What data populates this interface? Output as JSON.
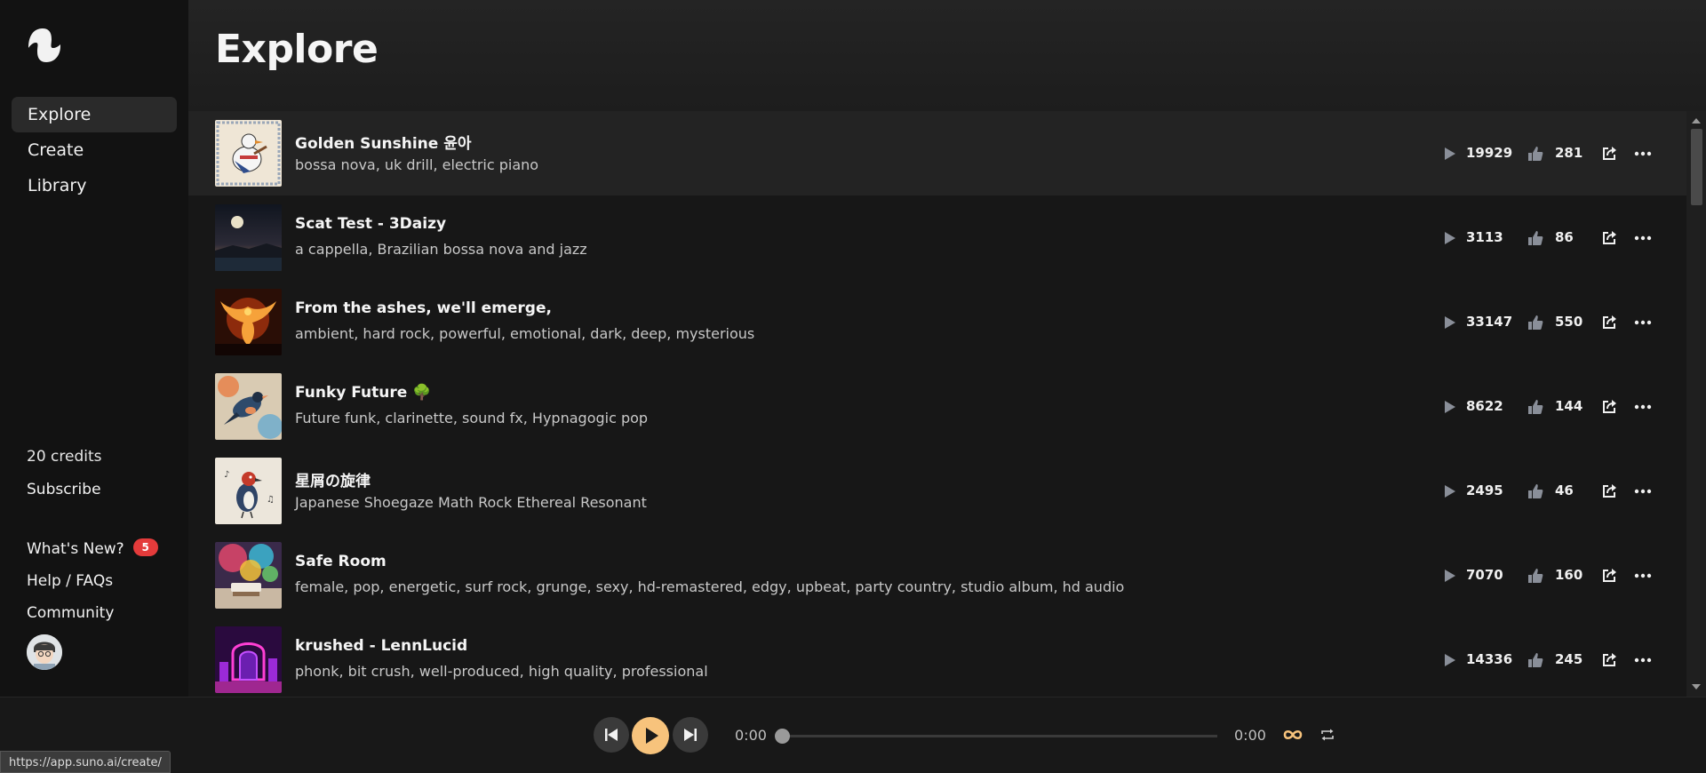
{
  "sidebar": {
    "nav": [
      {
        "label": "Explore",
        "active": true
      },
      {
        "label": "Create"
      },
      {
        "label": "Library"
      }
    ],
    "credits": "20 credits",
    "subscribe": "Subscribe",
    "links": [
      {
        "label": "What's New?",
        "badge": "5"
      },
      {
        "label": "Help / FAQs"
      },
      {
        "label": "Community"
      }
    ]
  },
  "header": {
    "title": "Explore"
  },
  "songs": [
    {
      "title": "Golden Sunshine 윤아",
      "tags": "bossa nova, uk drill, electric piano",
      "plays": "19929",
      "likes": "281",
      "art": "goose"
    },
    {
      "title": "Scat Test - 3Daizy",
      "tags": "a cappella, Brazilian bossa nova and jazz",
      "plays": "3113",
      "likes": "86",
      "art": "moon"
    },
    {
      "title": "From the ashes, we'll emerge,",
      "tags": "ambient, hard rock, powerful, emotional, dark, deep, mysterious",
      "plays": "33147",
      "likes": "550",
      "art": "phoenix"
    },
    {
      "title": "Funky Future 🌳",
      "tags": "Future funk, clarinette, sound fx, Hypnagogic pop",
      "plays": "8622",
      "likes": "144",
      "art": "bird-blue"
    },
    {
      "title": "星屑の旋律",
      "tags": "Japanese Shoegaze Math Rock Ethereal Resonant",
      "plays": "2495",
      "likes": "46",
      "art": "bird-red"
    },
    {
      "title": "Safe Room",
      "tags": "female, pop, energetic, surf rock, grunge, sexy, hd-remastered, edgy, upbeat, party country, studio album, hd audio",
      "plays": "7070",
      "likes": "160",
      "art": "room"
    },
    {
      "title": "krushed - LennLucid",
      "tags": "phonk, bit crush, well-produced, high quality, professional",
      "plays": "14336",
      "likes": "245",
      "art": "neon"
    }
  ],
  "player": {
    "current_time": "0:00",
    "duration": "0:00",
    "progress": 0
  },
  "status_url": "https://app.suno.ai/create/",
  "colors": {
    "accent": "#f7c37c",
    "badge": "#e43b3b",
    "background": "#171717"
  }
}
